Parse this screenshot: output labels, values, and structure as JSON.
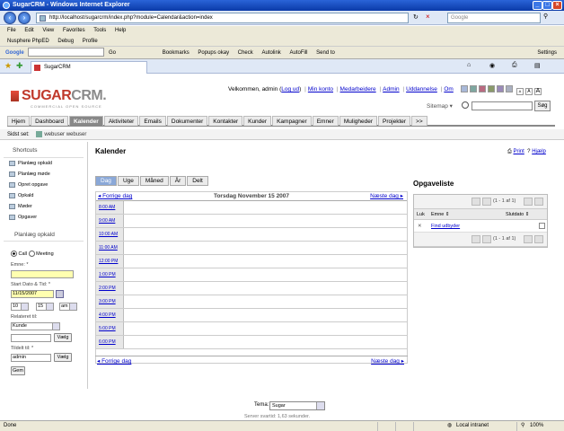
{
  "browser": {
    "title": "SugarCRM - Windows Internet Explorer",
    "url": "http://localhost/sugarcrm/index.php?module=Calendar&action=index",
    "search_placeholder": "Google",
    "menu": [
      "File",
      "Edit",
      "View",
      "Favorites",
      "Tools",
      "Help"
    ],
    "links": [
      "Nusphere PhpED",
      "Debug",
      "Profile"
    ],
    "gbar_label": "Google",
    "gbar_go": "Go",
    "gbar_items": [
      "Bookmarks",
      "Popups okay",
      "Check",
      "Autolink",
      "AutoFill",
      "Send to"
    ],
    "gbar_settings": "Settings",
    "tab_label": "SugarCRM",
    "status_left": "Done",
    "status_zone": "Local intranet",
    "status_zoom": "100%"
  },
  "header": {
    "logo_main": "SUGAR",
    "logo_crm": "CRM.",
    "tagline": "COMMERCIAL OPEN SOURCE",
    "welcome_prefix": "Velkommen, admin",
    "logout": "Log ud",
    "links": [
      "Min konto",
      "Medarbeidere",
      "Admin",
      "Uddannelse",
      "Om"
    ],
    "swatch_colors": [
      "#a8b8d8",
      "#7ea7a0",
      "#b96a80",
      "#8a9a6a",
      "#9a8ab8",
      "#aab0c0"
    ],
    "font_sizes": [
      "A",
      "A",
      "A"
    ],
    "sitemap": "Sitemap",
    "search_button": "Søg"
  },
  "nav": {
    "tabs": [
      "Hjem",
      "Dashboard",
      "Kalender",
      "Aktiviteter",
      "Emails",
      "Dokumenter",
      "Kontakter",
      "Kunder",
      "Kampagner",
      "Emner",
      "Muligheder",
      "Projekter",
      ">>"
    ],
    "active": "Kalender"
  },
  "lastview": {
    "label": "Sidst set:",
    "item": "webuser webuser"
  },
  "shortcuts": {
    "title": "Shortcuts",
    "items": [
      "Planlæg opkald",
      "Planlæg møde",
      "Opret opgave",
      "Opkald",
      "Møder",
      "Opgaver"
    ]
  },
  "quickcreate": {
    "title": "Planlæg opkald",
    "radio_call": "Call",
    "radio_meeting": "Meeting",
    "emne_label": "Emne: *",
    "emne_value": "",
    "start_label": "Start Dato & Tid: *",
    "start_date": "11/15/2007",
    "hour": "10",
    "minute": "15",
    "ampm": "am",
    "related_label": "Relateret til:",
    "related_value": "Kunde",
    "select_button": "Vælg",
    "assigned_label": "Tildelt til: *",
    "assigned_value": "admin",
    "save_button": "Gem"
  },
  "calendar": {
    "title": "Kalender",
    "print": "Print",
    "help": "Hjælp",
    "view_tabs": [
      "Dag",
      "Uge",
      "Måned",
      "År",
      "Delt"
    ],
    "active_view": "Dag",
    "prev": "Forrige dag",
    "next": "Næste dag",
    "date": "Torsdag November 15 2007",
    "hours": [
      "8:00 AM",
      "9:00 AM",
      "10:00 AM",
      "11:00 AM",
      "12:00 PM",
      "1:00 PM",
      "2:00 PM",
      "3:00 PM",
      "4:00 PM",
      "5:00 PM",
      "6:00 PM"
    ]
  },
  "tasks": {
    "title": "Opgaveliste",
    "pager": "(1 - 1 af 1)",
    "col_close": "Luk",
    "col_subject": "Emne",
    "col_due": "Slutdato",
    "rows": [
      {
        "subject": "Find udbyder",
        "due": ""
      }
    ]
  },
  "footer": {
    "theme_label": "Tema:",
    "theme_value": "Sugar",
    "generated": "Server svartid: 1,63 sekunder."
  }
}
